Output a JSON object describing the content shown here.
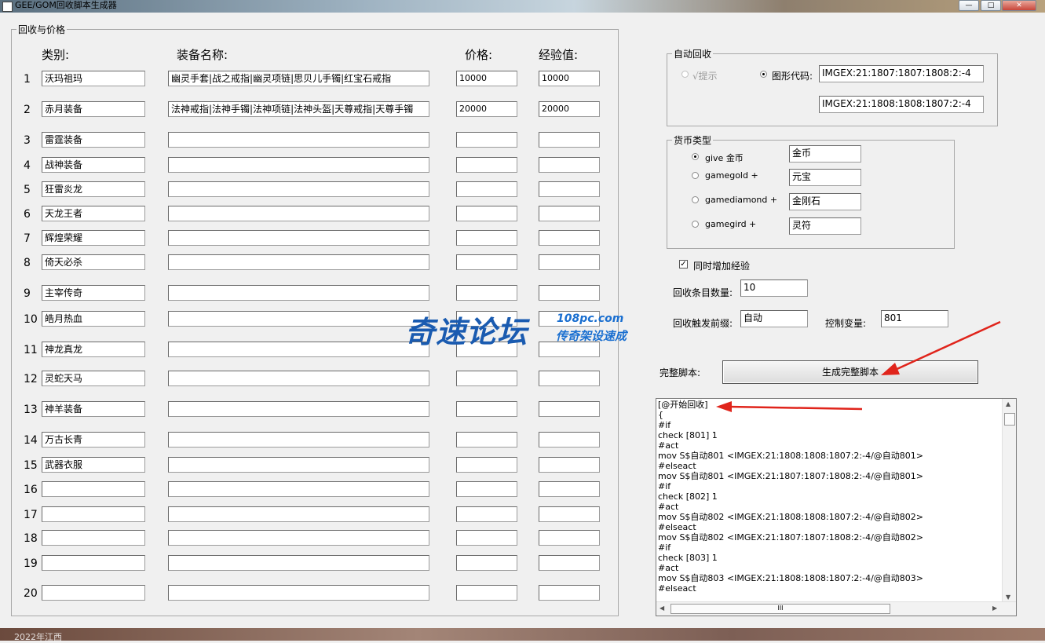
{
  "window": {
    "title": "GEE/GOM回收脚本生成器",
    "min": "—",
    "max": "□",
    "close": "✕"
  },
  "recycle_group": {
    "legend": "回收与价格",
    "headers": {
      "category": "类别:",
      "name": "装备名称:",
      "price": "价格:",
      "exp": "经验值:"
    },
    "rows": [
      {
        "num": "1",
        "category": "沃玛祖玛",
        "name": "幽灵手套|战之戒指|幽灵项链|思贝儿手镯|红宝石戒指",
        "price": "10000",
        "exp": "10000"
      },
      {
        "num": "2",
        "category": "赤月装备",
        "name": "法神戒指|法神手镯|法神项链|法神头盔|天尊戒指|天尊手镯",
        "price": "20000",
        "exp": "20000"
      },
      {
        "num": "3",
        "category": "雷霆装备",
        "name": "",
        "price": "",
        "exp": ""
      },
      {
        "num": "4",
        "category": "战神装备",
        "name": "",
        "price": "",
        "exp": ""
      },
      {
        "num": "5",
        "category": "狂雷炎龙",
        "name": "",
        "price": "",
        "exp": ""
      },
      {
        "num": "6",
        "category": "天龙王者",
        "name": "",
        "price": "",
        "exp": ""
      },
      {
        "num": "7",
        "category": "辉煌荣耀",
        "name": "",
        "price": "",
        "exp": ""
      },
      {
        "num": "8",
        "category": "倚天必杀",
        "name": "",
        "price": "",
        "exp": ""
      },
      {
        "num": "9",
        "category": "主宰传奇",
        "name": "",
        "price": "",
        "exp": ""
      },
      {
        "num": "10",
        "category": "皓月热血",
        "name": "",
        "price": "",
        "exp": ""
      },
      {
        "num": "11",
        "category": "神龙真龙",
        "name": "",
        "price": "",
        "exp": ""
      },
      {
        "num": "12",
        "category": "灵蛇天马",
        "name": "",
        "price": "",
        "exp": ""
      },
      {
        "num": "13",
        "category": "神羊装备",
        "name": "",
        "price": "",
        "exp": ""
      },
      {
        "num": "14",
        "category": "万古长青",
        "name": "",
        "price": "",
        "exp": ""
      },
      {
        "num": "15",
        "category": "武器衣服",
        "name": "",
        "price": "",
        "exp": ""
      },
      {
        "num": "16",
        "category": "",
        "name": "",
        "price": "",
        "exp": ""
      },
      {
        "num": "17",
        "category": "",
        "name": "",
        "price": "",
        "exp": ""
      },
      {
        "num": "18",
        "category": "",
        "name": "",
        "price": "",
        "exp": ""
      },
      {
        "num": "19",
        "category": "",
        "name": "",
        "price": "",
        "exp": ""
      },
      {
        "num": "20",
        "category": "",
        "name": "",
        "price": "",
        "exp": ""
      }
    ]
  },
  "auto_recycle": {
    "legend": "自动回收",
    "hint_option": "√提示",
    "graphic_option": "图形代码:",
    "code1": "IMGEX:21:1807:1807:1808:2:-4",
    "code2": "IMGEX:21:1808:1808:1807:2:-4"
  },
  "currency": {
    "legend": "货币类型",
    "options": [
      {
        "label": "give 金币",
        "value": "金币",
        "selected": true
      },
      {
        "label": "gamegold +",
        "value": "元宝",
        "selected": false
      },
      {
        "label": "gamediamond +",
        "value": "金刚石",
        "selected": false
      },
      {
        "label": "gamegird +",
        "value": "灵符",
        "selected": false
      }
    ]
  },
  "settings": {
    "add_exp_label": "同时增加经验",
    "add_exp_checked": true,
    "count_label": "回收条目数量:",
    "count_value": "10",
    "prefix_label": "回收触发前缀:",
    "prefix_value": "自动",
    "var_label": "控制变量:",
    "var_value": "801"
  },
  "generate": {
    "label": "完整脚本:",
    "button": "生成完整脚本"
  },
  "script_lines": [
    "[@开始回收]",
    "{",
    "#if",
    "check [801] 1",
    "#act",
    "mov S$自动801 <IMGEX:21:1808:1808:1807:2:-4/@自动801>",
    "#elseact",
    "mov S$自动801 <IMGEX:21:1807:1807:1808:2:-4/@自动801>",
    "#if",
    "check [802] 1",
    "#act",
    "mov S$自动802 <IMGEX:21:1808:1808:1807:2:-4/@自动802>",
    "#elseact",
    "mov S$自动802 <IMGEX:21:1807:1807:1808:2:-4/@自动802>",
    "#if",
    "check [803] 1",
    "#act",
    "mov S$自动803 <IMGEX:21:1808:1808:1807:2:-4/@自动803>",
    "#elseact"
  ],
  "scroll_grip": "III",
  "watermark": {
    "main": "奇速论坛",
    "site": "108pc.com",
    "sub": "传奇架设速成"
  },
  "taskbar_text": "2022年江西",
  "colors": {
    "arrow": "#e0241b",
    "watermark": "#1a5bb0"
  }
}
